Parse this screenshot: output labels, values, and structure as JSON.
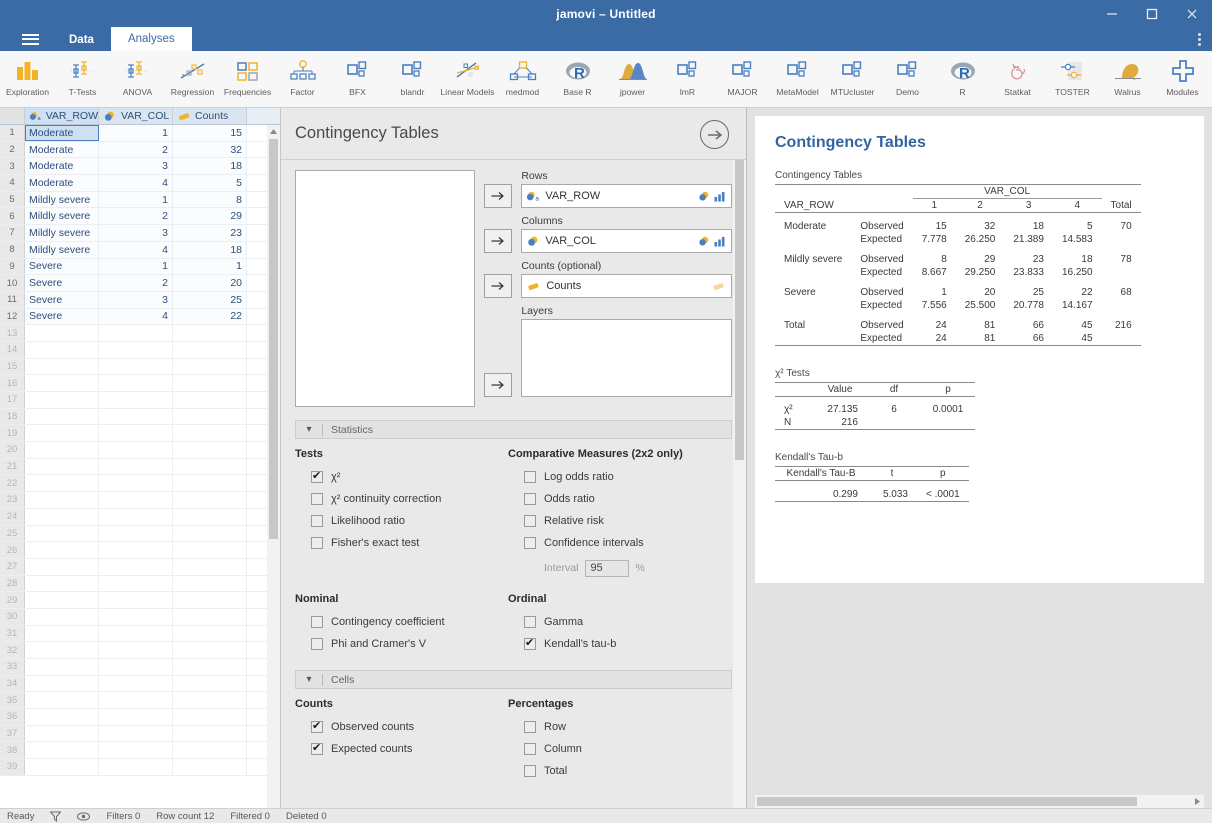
{
  "window": {
    "title": "jamovi – Untitled",
    "controls": {
      "minimize": "minimize-icon",
      "maximize": "maximize-icon",
      "close": "close-icon",
      "overflow": "more-options-icon"
    }
  },
  "tabs": [
    {
      "label": "Data",
      "active": false
    },
    {
      "label": "Analyses",
      "active": true
    }
  ],
  "ribbon": [
    {
      "label": "Exploration",
      "icon": "bar-chart-icon"
    },
    {
      "label": "T-Tests",
      "icon": "error-bars-icon"
    },
    {
      "label": "ANOVA",
      "icon": "error-bars-icon"
    },
    {
      "label": "Regression",
      "icon": "scatter-line-icon"
    },
    {
      "label": "Frequencies",
      "icon": "squares-grid-icon"
    },
    {
      "label": "Factor",
      "icon": "factor-tree-icon"
    },
    {
      "label": "BFX",
      "icon": "module-squares-icon"
    },
    {
      "label": "blandr",
      "icon": "module-squares-icon"
    },
    {
      "label": "Linear Models",
      "icon": "scatter-lines-icon"
    },
    {
      "label": "medmod",
      "icon": "mediation-icon"
    },
    {
      "label": "Base R",
      "icon": "r-logo-icon"
    },
    {
      "label": "jpower",
      "icon": "distribution-curves-icon"
    },
    {
      "label": "lmR",
      "icon": "module-squares-icon"
    },
    {
      "label": "MAJOR",
      "icon": "module-squares-icon"
    },
    {
      "label": "MetaModel",
      "icon": "module-squares-icon"
    },
    {
      "label": "MTUcluster",
      "icon": "module-squares-icon"
    },
    {
      "label": "Demo",
      "icon": "module-squares-icon"
    },
    {
      "label": "R",
      "icon": "r-logo-icon"
    },
    {
      "label": "Statkat",
      "icon": "cat-icon"
    },
    {
      "label": "TOSTER",
      "icon": "toster-icon"
    },
    {
      "label": "Walrus",
      "icon": "walrus-icon"
    },
    {
      "label": "Modules",
      "icon": "plus-icon"
    }
  ],
  "spreadsheet": {
    "columns": [
      {
        "name": "VAR_ROW",
        "type": "nominal-text-icon"
      },
      {
        "name": "VAR_COL",
        "type": "nominal-icon"
      },
      {
        "name": "Counts",
        "type": "continuous-icon"
      }
    ],
    "rows": [
      {
        "n": "1",
        "VAR_ROW": "Moderate",
        "VAR_COL": "1",
        "Counts": "15"
      },
      {
        "n": "2",
        "VAR_ROW": "Moderate",
        "VAR_COL": "2",
        "Counts": "32"
      },
      {
        "n": "3",
        "VAR_ROW": "Moderate",
        "VAR_COL": "3",
        "Counts": "18"
      },
      {
        "n": "4",
        "VAR_ROW": "Moderate",
        "VAR_COL": "4",
        "Counts": "5"
      },
      {
        "n": "5",
        "VAR_ROW": "Mildly severe",
        "VAR_COL": "1",
        "Counts": "8"
      },
      {
        "n": "6",
        "VAR_ROW": "Mildly severe",
        "VAR_COL": "2",
        "Counts": "29"
      },
      {
        "n": "7",
        "VAR_ROW": "Mildly severe",
        "VAR_COL": "3",
        "Counts": "23"
      },
      {
        "n": "8",
        "VAR_ROW": "Mildly severe",
        "VAR_COL": "4",
        "Counts": "18"
      },
      {
        "n": "9",
        "VAR_ROW": "Severe",
        "VAR_COL": "1",
        "Counts": "1"
      },
      {
        "n": "10",
        "VAR_ROW": "Severe",
        "VAR_COL": "2",
        "Counts": "20"
      },
      {
        "n": "11",
        "VAR_ROW": "Severe",
        "VAR_COL": "3",
        "Counts": "25"
      },
      {
        "n": "12",
        "VAR_ROW": "Severe",
        "VAR_COL": "4",
        "Counts": "22"
      }
    ],
    "empty_row_numbers": [
      "13",
      "14",
      "15",
      "16",
      "17",
      "18",
      "19",
      "20",
      "21",
      "22",
      "23",
      "24",
      "25",
      "26",
      "27",
      "28",
      "29",
      "30",
      "31",
      "32",
      "33",
      "34",
      "35",
      "36",
      "37",
      "38",
      "39"
    ]
  },
  "options": {
    "title": "Contingency Tables",
    "next_icon": "arrow-right-circle-icon",
    "assignments": [
      {
        "label": "Rows",
        "value": "VAR_ROW",
        "var_icon": "nominal-text-icon"
      },
      {
        "label": "Columns",
        "value": "VAR_COL",
        "var_icon": "nominal-icon"
      },
      {
        "label": "Counts (optional)",
        "value": "Counts",
        "var_icon": "continuous-icon"
      }
    ],
    "layers_label": "Layers",
    "sections": {
      "statistics": {
        "title": "Statistics",
        "tests_title": "Tests",
        "tests": [
          {
            "label": "χ²",
            "checked": true
          },
          {
            "label": "χ² continuity correction",
            "checked": false
          },
          {
            "label": "Likelihood ratio",
            "checked": false
          },
          {
            "label": "Fisher's exact test",
            "checked": false
          }
        ],
        "comparative_title": "Comparative Measures (2x2 only)",
        "comparative": [
          {
            "label": "Log odds ratio",
            "checked": false
          },
          {
            "label": "Odds ratio",
            "checked": false
          },
          {
            "label": "Relative risk",
            "checked": false
          },
          {
            "label": "Confidence intervals",
            "checked": false
          }
        ],
        "interval_label": "Interval",
        "interval_value": "95",
        "interval_unit": "%",
        "nominal_title": "Nominal",
        "nominal": [
          {
            "label": "Contingency coefficient",
            "checked": false
          },
          {
            "label": "Phi and Cramer's V",
            "checked": false
          }
        ],
        "ordinal_title": "Ordinal",
        "ordinal": [
          {
            "label": "Gamma",
            "checked": false
          },
          {
            "label": "Kendall's tau-b",
            "checked": true
          }
        ]
      },
      "cells": {
        "title": "Cells",
        "counts_title": "Counts",
        "counts": [
          {
            "label": "Observed counts",
            "checked": true
          },
          {
            "label": "Expected counts",
            "checked": true
          }
        ],
        "percentages_title": "Percentages",
        "percentages": [
          {
            "label": "Row",
            "checked": false
          },
          {
            "label": "Column",
            "checked": false
          },
          {
            "label": "Total",
            "checked": false
          }
        ]
      }
    }
  },
  "results": {
    "heading": "Contingency Tables",
    "contingency": {
      "caption": "Contingency Tables",
      "row_var": "VAR_ROW",
      "col_var": "VAR_COL",
      "col_levels": [
        "1",
        "2",
        "3",
        "4"
      ],
      "total_label": "Total",
      "observed_label": "Observed",
      "expected_label": "Expected",
      "rows": [
        {
          "level": "Moderate",
          "observed": [
            "15",
            "32",
            "18",
            "5"
          ],
          "expected": [
            "7.778",
            "26.250",
            "21.389",
            "14.583"
          ],
          "total": "70"
        },
        {
          "level": "Mildly severe",
          "observed": [
            "8",
            "29",
            "23",
            "18"
          ],
          "expected": [
            "8.667",
            "29.250",
            "23.833",
            "16.250"
          ],
          "total": "78"
        },
        {
          "level": "Severe",
          "observed": [
            "1",
            "20",
            "25",
            "22"
          ],
          "expected": [
            "7.556",
            "25.500",
            "20.778",
            "14.167"
          ],
          "total": "68"
        },
        {
          "level": "Total",
          "observed": [
            "24",
            "81",
            "66",
            "45"
          ],
          "expected": [
            "24",
            "81",
            "66",
            "45"
          ],
          "total": "216"
        }
      ]
    },
    "chisq": {
      "caption": "χ² Tests",
      "headers": [
        "",
        "Value",
        "df",
        "p"
      ],
      "rows": [
        {
          "name": "χ²",
          "value": "27.135",
          "df": "6",
          "p": "0.0001"
        },
        {
          "name": "N",
          "value": "216",
          "df": "",
          "p": ""
        }
      ]
    },
    "kendall": {
      "caption": "Kendall's Tau-b",
      "headers": [
        "Kendall's Tau-B",
        "t",
        "p"
      ],
      "rows": [
        {
          "tau": "0.299",
          "t": "5.033",
          "p": "< .0001"
        }
      ]
    }
  },
  "status": {
    "ready": "Ready",
    "filter_icon": "funnel-icon",
    "eye_icon": "eye-icon",
    "filters": "Filters 0",
    "row_count": "Row count 12",
    "filtered": "Filtered 0",
    "deleted": "Deleted 0"
  },
  "colors": {
    "titlebar": "#3b6ba5",
    "accent": "#3366a0",
    "panel": "#e9e9e9",
    "results_bg": "#e2e2e2"
  }
}
